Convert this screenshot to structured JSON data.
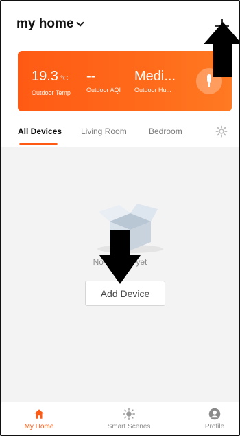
{
  "header": {
    "home_name": "my home"
  },
  "weather": {
    "items": [
      {
        "value": "19.3",
        "unit": "°C",
        "label": "Outdoor Temp"
      },
      {
        "value": "--",
        "unit": "",
        "label": "Outdoor AQI"
      },
      {
        "value": "Medi...",
        "unit": "",
        "label": "Outdoor Hu..."
      }
    ]
  },
  "tabs": [
    {
      "label": "All Devices",
      "active": true
    },
    {
      "label": "Living Room",
      "active": false
    },
    {
      "label": "Bedroom",
      "active": false
    }
  ],
  "empty_state": {
    "message": "No devices yet",
    "add_button_label": "Add Device"
  },
  "bottom_nav": [
    {
      "label": "My Home",
      "icon": "home-icon",
      "active": true
    },
    {
      "label": "Smart Scenes",
      "icon": "sun-icon",
      "active": false
    },
    {
      "label": "Profile",
      "icon": "profile-icon",
      "active": false
    }
  ],
  "colors": {
    "accent": "#ff5a14",
    "background": "#f3f3f3"
  }
}
